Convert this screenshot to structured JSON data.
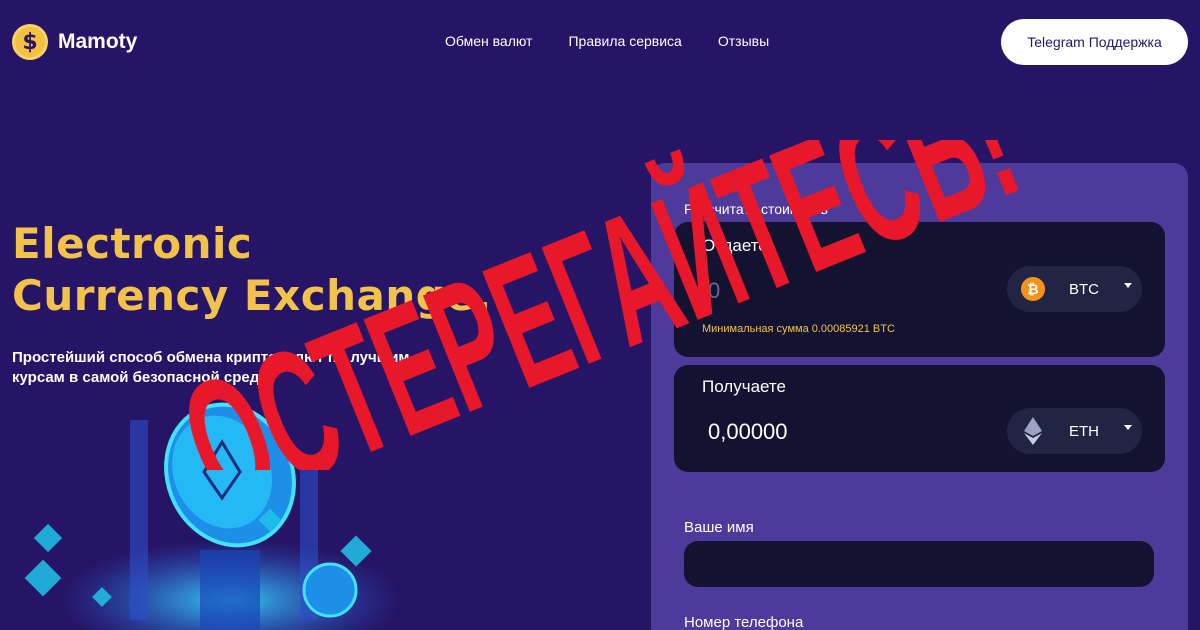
{
  "brand": {
    "logo_symbol": "$",
    "name": "Mamoty"
  },
  "nav": [
    {
      "label": "Обмен валют"
    },
    {
      "label": "Правила сервиса"
    },
    {
      "label": "Отзывы"
    }
  ],
  "header": {
    "support_label": "Telegram Поддержка"
  },
  "hero": {
    "title_line1": "Electronic",
    "title_line2": "Currency Exchange.",
    "subtitle": "Простейший способ обмена криптовалют по лучшим курсам в самой безопасной среде."
  },
  "form": {
    "calc_label": "Рассчитать стоимость",
    "give": {
      "label": "Отдаете",
      "amount": "0",
      "currency": "BTC",
      "min_text": "Минимальная сумма 0.00085921 BTC"
    },
    "get": {
      "label": "Получаете",
      "amount": "0,00000",
      "currency": "ETH"
    },
    "name_label": "Ваше имя",
    "phone_label": "Номер телефона"
  },
  "overlay": {
    "warning_text": "ОСТЕРЕГАЙТЕСЬ!",
    "warning_color": "#e8182a"
  },
  "colors": {
    "background": "#261566",
    "accent": "#f2c24a",
    "panel": "#4d3a9a",
    "field": "#131230"
  }
}
